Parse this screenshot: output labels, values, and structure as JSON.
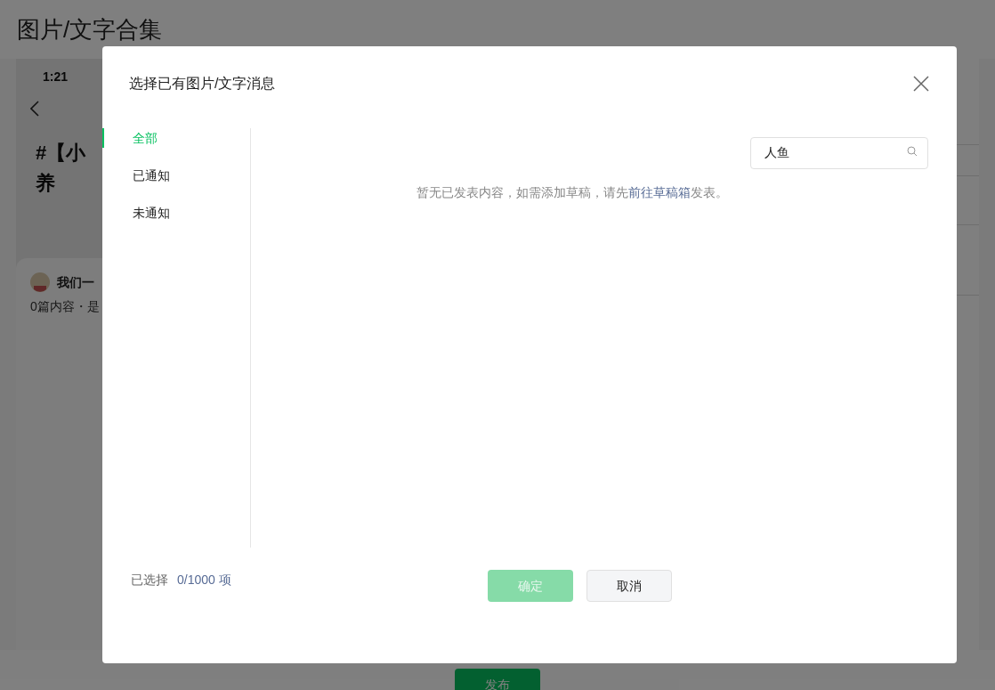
{
  "page": {
    "title": "图片/文字合集",
    "preview": {
      "time": "1:21",
      "heading_lines": [
        "#【小",
        "养"
      ],
      "card": {
        "author": "我们一",
        "meta": "0篇内容・是"
      }
    },
    "publish_button": "发布"
  },
  "dialog": {
    "title": "选择已有图片/文字消息",
    "nav": [
      {
        "label": "全部",
        "selected": true
      },
      {
        "label": "已通知",
        "selected": false
      },
      {
        "label": "未通知",
        "selected": false
      }
    ],
    "search": {
      "value": "人鱼"
    },
    "empty_message": {
      "before": "暂无已发表内容，如需添加草稿，请先",
      "link": "前往草稿箱",
      "after": "发表。"
    },
    "selection": {
      "label": "已选择",
      "count": "0/1000 项"
    },
    "buttons": [
      {
        "label": "确定",
        "kind": "primary",
        "disabled": true
      },
      {
        "label": "取消",
        "kind": "secondary",
        "disabled": false
      }
    ]
  }
}
